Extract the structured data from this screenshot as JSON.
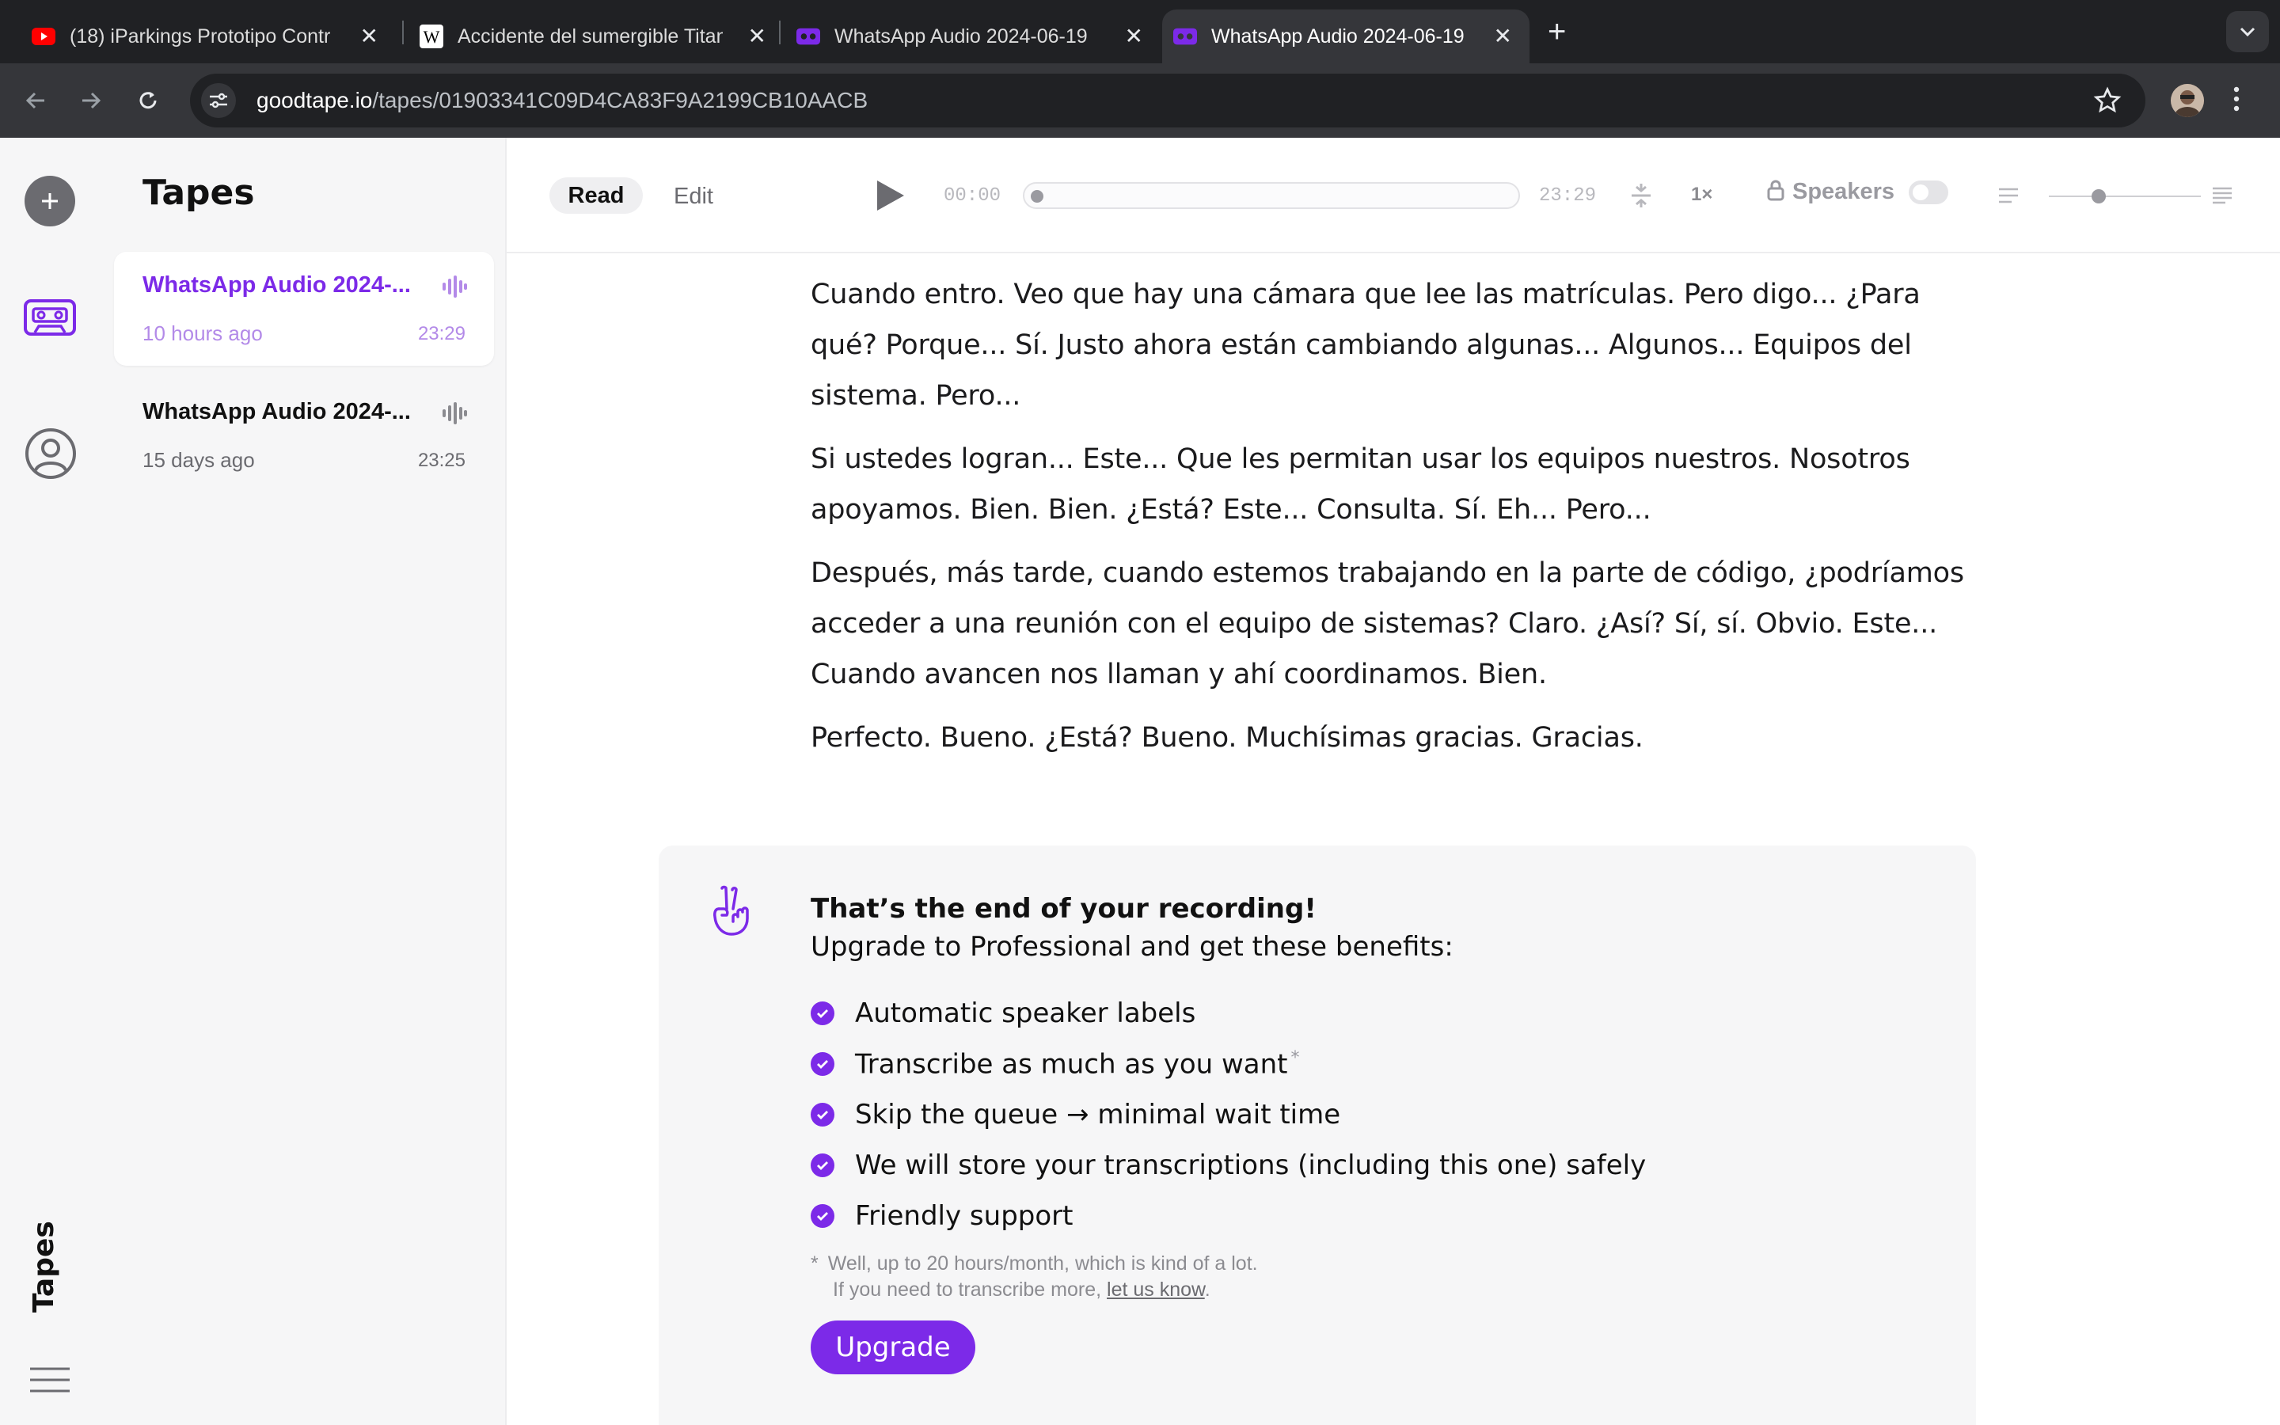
{
  "browser": {
    "tabs": [
      {
        "title": "(18) iParkings Prototipo Contr",
        "icon": "youtube-icon",
        "active": false
      },
      {
        "title": "Accidente del sumergible Titan",
        "icon": "wikipedia-icon",
        "active": false
      },
      {
        "title": "WhatsApp Audio 2024-06-19",
        "icon": "goodtape-icon",
        "active": false
      },
      {
        "title": "WhatsApp Audio 2024-06-19",
        "icon": "goodtape-icon",
        "active": true
      }
    ],
    "url_host": "goodtape.io",
    "url_path": "/tapes/01903341C09D4CA83F9A2199CB10AACB"
  },
  "sidebar": {
    "vertical_label": "Tapes",
    "items": [
      "add-icon",
      "tapes-icon",
      "account-icon",
      "menu-icon"
    ]
  },
  "tape_list": {
    "heading": "Tapes",
    "items": [
      {
        "title": "WhatsApp Audio 2024-...",
        "age": "10 hours ago",
        "duration": "23:29",
        "selected": true
      },
      {
        "title": "WhatsApp Audio 2024-...",
        "age": "15 days ago",
        "duration": "23:25",
        "selected": false
      }
    ]
  },
  "player": {
    "mode_read": "Read",
    "mode_edit": "Edit",
    "current_time": "00:00",
    "total_time": "23:29",
    "progress_fraction": 0.0,
    "speed": "1×",
    "speakers_label": "Speakers",
    "speakers_enabled": false,
    "text_size_fraction": 0.33
  },
  "transcript": {
    "paragraphs": [
      "Cuando entro. Veo que hay una cámara que lee las matrículas. Pero digo... ¿Para qué? Porque... Sí. Justo ahora están cambiando algunas... Algunos... Equipos del sistema. Pero...",
      "Si ustedes logran... Este... Que les permitan usar los equipos nuestros. Nosotros apoyamos. Bien. Bien. ¿Está? Este... Consulta. Sí. Eh... Pero...",
      "Después, más tarde, cuando estemos trabajando en la parte de código, ¿podríamos acceder a una reunión con el equipo de sistemas? Claro. ¿Así? Sí, sí. Obvio. Este... Cuando avancen nos llaman y ahí coordinamos. Bien.",
      "Perfecto. Bueno. ¿Está? Bueno. Muchísimas gracias. Gracias."
    ]
  },
  "upsell": {
    "headline": "That’s the end of your recording!",
    "subline": "Upgrade to Professional and get these benefits:",
    "benefits": [
      "Automatic speaker labels",
      "Transcribe as much as you want",
      "Skip the queue → minimal wait time",
      "We will store your transcriptions (including this one) safely",
      "Friendly support"
    ],
    "benefit_star": "*",
    "footnote_star": "*",
    "footnote_line1": "Well, up to 20 hours/month, which is kind of a lot.",
    "footnote_line2_prefix": "If you need to transcribe more, ",
    "footnote_link": "let us know",
    "footnote_line2_suffix": ".",
    "button": "Upgrade"
  },
  "colors": {
    "accent": "#7c2ae8",
    "accent_light": "#b38ae8",
    "chrome_dark": "#202124",
    "chrome_mid": "#35363a"
  }
}
